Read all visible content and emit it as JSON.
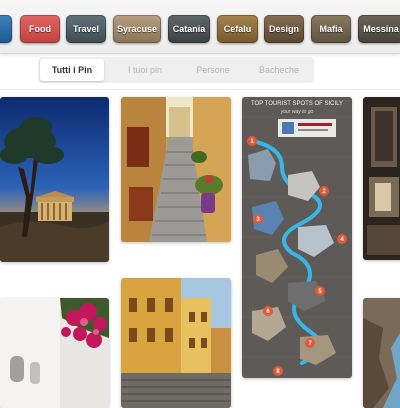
{
  "categories": [
    {
      "label": "",
      "color": "#2a6aa4"
    },
    {
      "label": "Food",
      "color": "#d45050"
    },
    {
      "label": "Travel",
      "color": "#4e6068"
    },
    {
      "label": "Syracuse",
      "color": "#a08b6c"
    },
    {
      "label": "Catania",
      "color": "#4d5356"
    },
    {
      "label": "Cefalu",
      "color": "#8f6c3c"
    },
    {
      "label": "Design",
      "color": "#6f5b42"
    },
    {
      "label": "Mafia",
      "color": "#75674f"
    },
    {
      "label": "Messina",
      "color": "#5a544a"
    }
  ],
  "tabs": [
    {
      "label": "Tutti i Pin",
      "active": true
    },
    {
      "label": "I tuoi pin",
      "active": false
    },
    {
      "label": "Persone",
      "active": false
    },
    {
      "label": "Bacheche",
      "active": false
    }
  ],
  "infographic": {
    "title": "TOP TOURIST SPOTS OF SICILY",
    "subtitle": "your way to go",
    "numbers": [
      "1",
      "2",
      "3",
      "4",
      "5",
      "6",
      "7",
      "8"
    ]
  }
}
